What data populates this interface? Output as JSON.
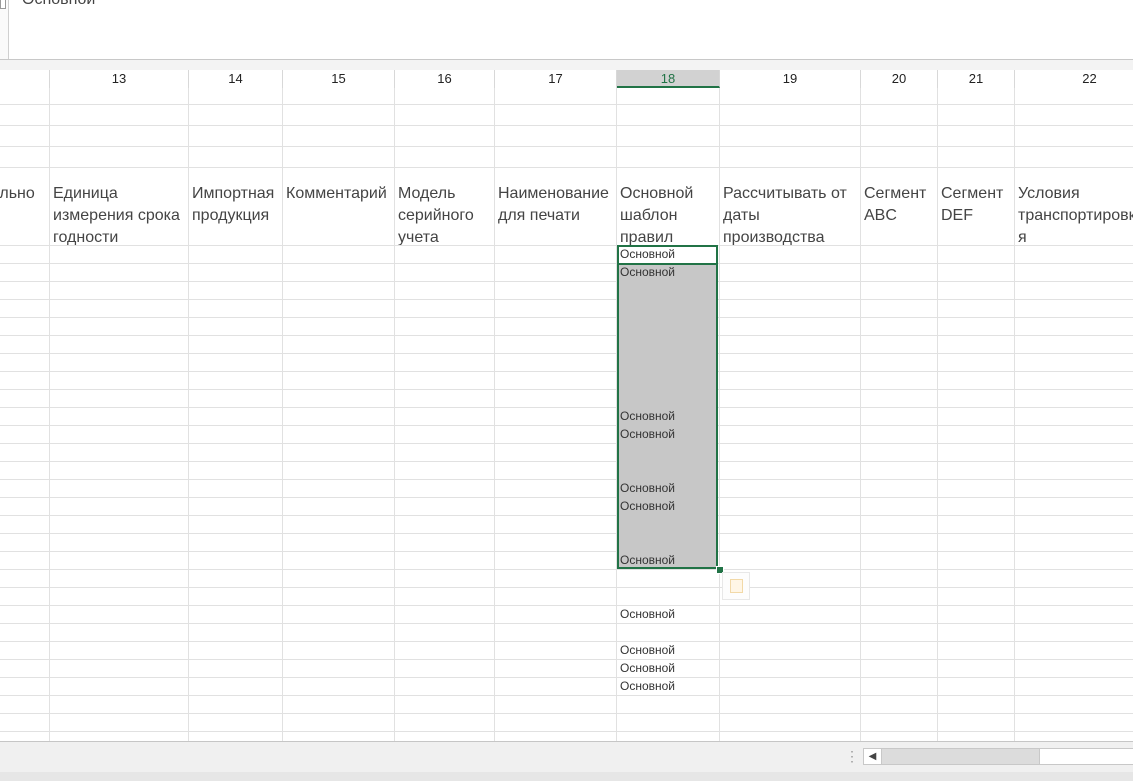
{
  "formula_bar": {
    "value": "Основной"
  },
  "columns": [
    {
      "label": "13",
      "header": "Единица измерения срока годности"
    },
    {
      "label": "14",
      "header": "Импортная продукция"
    },
    {
      "label": "15",
      "header": "Комментарий"
    },
    {
      "label": "16",
      "header": "Модель серийного учета"
    },
    {
      "label": "17",
      "header": "Наименование для печати"
    },
    {
      "label": "18",
      "header": "Основной шаблон правил",
      "active": true
    },
    {
      "label": "19",
      "header": "Рассчитывать от даты производства"
    },
    {
      "label": "20",
      "header": "Сегмент ABC"
    },
    {
      "label": "21",
      "header": "Сегмент DEF"
    },
    {
      "label": "22",
      "header": "Условия транспортировки я"
    }
  ],
  "partial_header": "ельно е",
  "cell_values": {
    "active": "Основной",
    "r2": "Основной",
    "r10": "Основной",
    "r11": "Основной",
    "r14": "Основной",
    "r15": "Основной",
    "r18": "Основной",
    "r21": "Основной",
    "r23": "Основной",
    "r24": "Основной",
    "r25": "Основной"
  },
  "scroll": {
    "left_arrow": "◀"
  }
}
